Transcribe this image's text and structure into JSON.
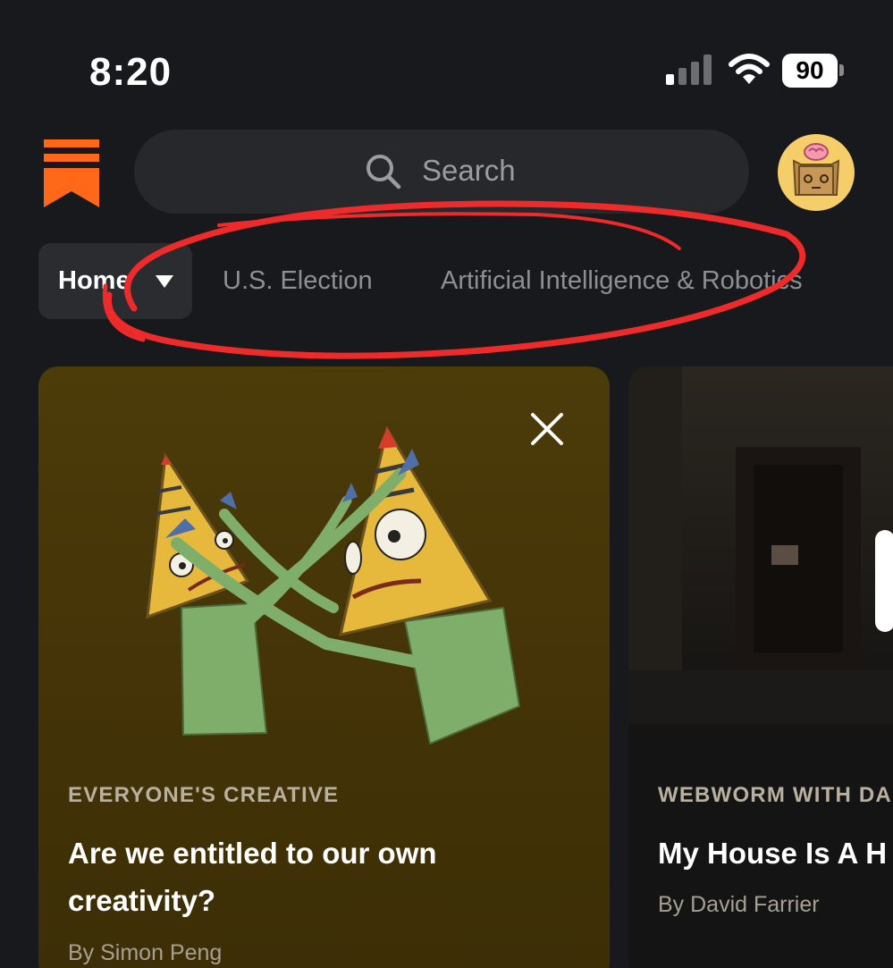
{
  "status_bar": {
    "time": "8:20",
    "battery": "90"
  },
  "header": {
    "logo_icon": "bookmark-stack-logo",
    "search": {
      "placeholder": "Search",
      "icon": "search-icon"
    },
    "avatar_icon": "box-robot-avatar"
  },
  "tabs": [
    {
      "label": "Home",
      "selected": true,
      "icon": "caret-down-icon"
    },
    {
      "label": "U.S. Election",
      "selected": false
    },
    {
      "label": "Artificial Intelligence & Robotics",
      "selected": false
    }
  ],
  "cards": [
    {
      "publication": "EVERYONE'S CREATIVE",
      "title_line1": "Are we entitled to our own",
      "title_line2": "creativity?",
      "byline": "By Simon Peng"
    },
    {
      "publication": "WEBWORM WITH DA",
      "title_line1": "My House Is A H",
      "byline": "By David Farrier"
    }
  ],
  "colors": {
    "brand": "#ff6719",
    "annotation": "#ee2a2a",
    "background": "#17191c"
  }
}
